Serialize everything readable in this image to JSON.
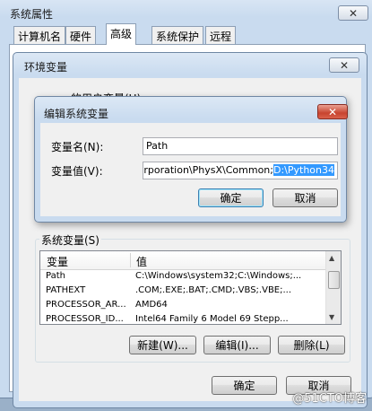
{
  "system_properties": {
    "title": "系统属性",
    "close": "✕",
    "tabs": [
      "计算机名",
      "硬件",
      "高级",
      "系统保护",
      "远程"
    ],
    "active_tab": 2
  },
  "env_vars": {
    "title": "环境变量",
    "close": "✕",
    "user_vars_label": "的用户变量(U)",
    "system_vars_label": "系统变量(S)",
    "columns": [
      "变量",
      "值"
    ],
    "rows": [
      {
        "name": "Path",
        "value": "C:\\Windows\\system32;C:\\Windows;..."
      },
      {
        "name": "PATHEXT",
        "value": ".COM;.EXE;.BAT;.CMD;.VBS;.VBE;..."
      },
      {
        "name": "PROCESSOR_AR...",
        "value": "AMD64"
      },
      {
        "name": "PROCESSOR_ID...",
        "value": "Intel64 Family 6 Model 69 Stepp..."
      }
    ],
    "new_button": "新建(W)...",
    "edit_button": "编辑(I)...",
    "delete_button": "删除(L)",
    "ok_button": "确定",
    "cancel_button": "取消"
  },
  "edit_dialog": {
    "title": "编辑系统变量",
    "close": "✕",
    "name_label": "变量名(N):",
    "value_label": "变量值(V):",
    "name_value": "Path",
    "value_plain": "Corporation\\PhysX\\Common;",
    "value_selected": "D:\\Python34",
    "ok_button": "确定",
    "cancel_button": "取消"
  },
  "watermark": "@51CTO博客",
  "colors": {
    "selection": "#3399ff",
    "close_red": "#c8442f"
  }
}
